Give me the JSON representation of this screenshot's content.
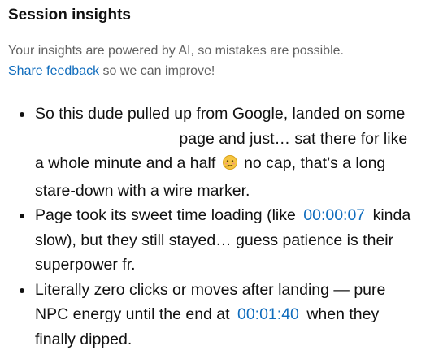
{
  "panel": {
    "title": "Session insights",
    "disclaimer": {
      "text": "Your insights are powered by AI, so mistakes are possible.",
      "link_label": "Share feedback",
      "suffix": "so we can improve!"
    }
  },
  "insights": [
    {
      "part1": "So this dude pulled up from Google, landed on some",
      "part2": "page and just… sat there for like a whole minute and a half",
      "emoji_icon": "face-emoji-icon",
      "part3": "no cap, that’s a long stare-down with a wire marker."
    },
    {
      "part1": "Page took its sweet time loading (like",
      "timestamp": "00:00:07",
      "part2": "kinda slow), but they still stayed… guess patience is their superpower fr."
    },
    {
      "part1": "Literally zero clicks or moves after landing — pure NPC energy until the end at",
      "timestamp": "00:01:40",
      "part2": "when they finally dipped."
    }
  ],
  "colors": {
    "link": "#0f6cbd",
    "text": "#111111",
    "muted": "#616161",
    "background": "#ffffff"
  }
}
